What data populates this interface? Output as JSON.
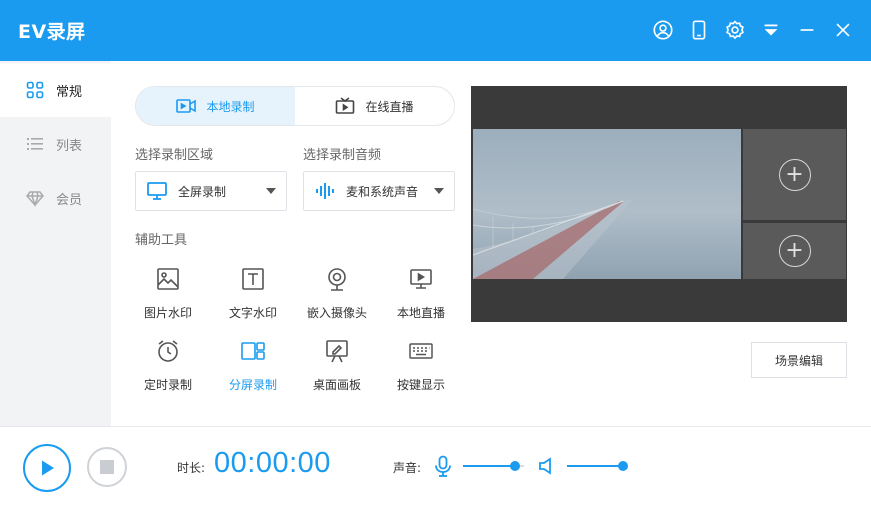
{
  "app": {
    "title": "EV录屏"
  },
  "sidebar": {
    "items": [
      {
        "label": "常规",
        "icon": "grid-icon",
        "active": true
      },
      {
        "label": "列表",
        "icon": "list-icon",
        "active": false
      },
      {
        "label": "会员",
        "icon": "diamond-icon",
        "active": false
      }
    ]
  },
  "mode_tabs": [
    {
      "label": "本地录制",
      "icon": "video-camera-icon",
      "active": true
    },
    {
      "label": "在线直播",
      "icon": "tv-icon",
      "active": false
    }
  ],
  "region": {
    "section_label": "选择录制区域",
    "value": "全屏录制",
    "icon": "monitor-icon"
  },
  "audio": {
    "section_label": "选择录制音频",
    "value": "麦和系统声音",
    "icon": "sound-wave-icon"
  },
  "tools": {
    "section_label": "辅助工具",
    "items": [
      {
        "label": "图片水印",
        "icon": "image-icon",
        "active": false
      },
      {
        "label": "文字水印",
        "icon": "text-icon",
        "active": false
      },
      {
        "label": "嵌入摄像头",
        "icon": "webcam-icon",
        "active": false
      },
      {
        "label": "本地直播",
        "icon": "live-screen-icon",
        "active": false
      },
      {
        "label": "定时录制",
        "icon": "alarm-clock-icon",
        "active": false
      },
      {
        "label": "分屏录制",
        "icon": "split-screen-icon",
        "active": true
      },
      {
        "label": "桌面画板",
        "icon": "easel-icon",
        "active": false
      },
      {
        "label": "按键显示",
        "icon": "keyboard-icon",
        "active": false
      }
    ]
  },
  "preview": {
    "add_symbol": "+",
    "scene_edit_label": "场景编辑"
  },
  "bottom": {
    "duration_label": "时长:",
    "timer": "00:00:00",
    "volume_label": "声音:",
    "mic_level": 0.85,
    "speaker_level": 1.0
  },
  "colors": {
    "accent": "#1a9bf0",
    "titlebar": "#1a9bf0",
    "sidebar_bg": "#f2f3f5"
  }
}
